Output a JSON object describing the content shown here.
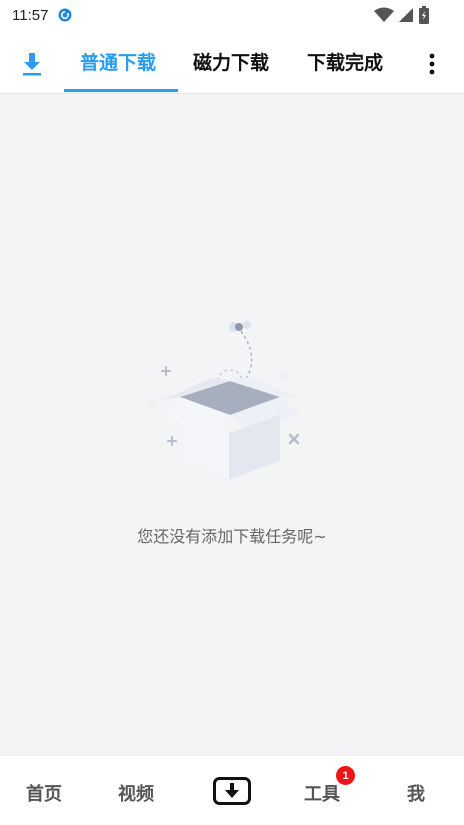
{
  "status_bar": {
    "time": "11:57",
    "icons": [
      "app-sync-icon",
      "wifi-icon",
      "signal-icon",
      "battery-icon"
    ]
  },
  "tabs": {
    "download_icon": "download-arrow-icon",
    "items": [
      {
        "label": "普通下载",
        "active": true
      },
      {
        "label": "磁力下载",
        "active": false
      },
      {
        "label": "下载完成",
        "active": false
      }
    ],
    "more_icon": "more-vertical-icon",
    "accent_color": "#2b9df0"
  },
  "empty_state": {
    "illustration": "open-empty-box-icon",
    "message": "您还没有添加下载任务呢~"
  },
  "bottom_nav": {
    "items": [
      {
        "label": "首页"
      },
      {
        "label": "视频"
      },
      {
        "label": "",
        "icon": "download-box-icon"
      },
      {
        "label": "工具",
        "badge": "1"
      },
      {
        "label": "我"
      }
    ],
    "badge_color": "#f01414"
  }
}
